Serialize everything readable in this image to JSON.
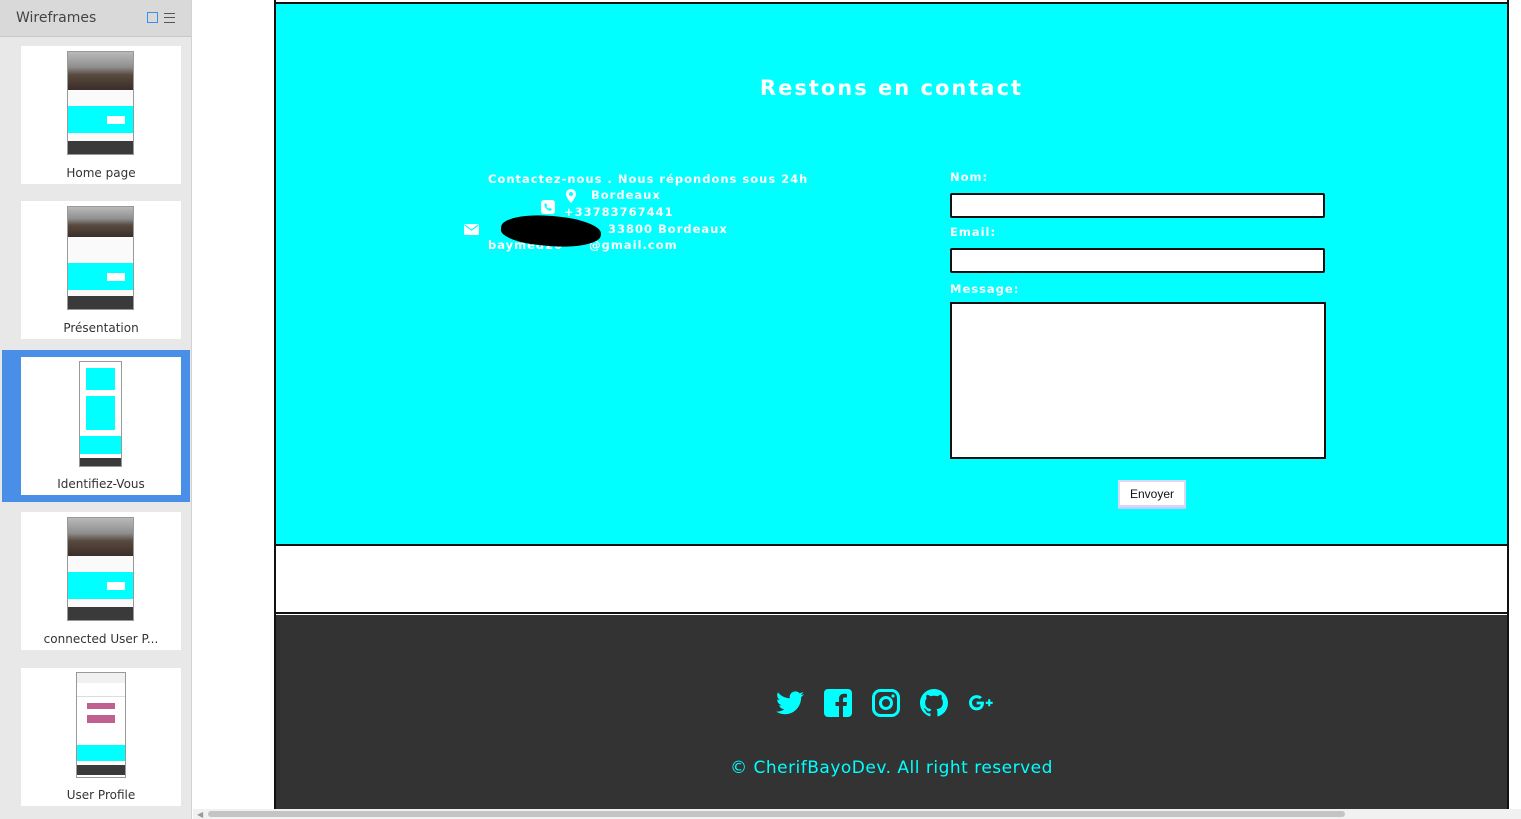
{
  "sidebar": {
    "title": "Wireframes",
    "pages": [
      {
        "label": "Home page"
      },
      {
        "label": "Présentation"
      },
      {
        "label": "Identifiez-Vous"
      },
      {
        "label": "connected User P..."
      },
      {
        "label": "User Profile"
      }
    ],
    "selected_index": 2
  },
  "contact": {
    "title": "Restons en contact",
    "intro": "Contactez-nous . Nous répondons sous 24h",
    "location": "Bordeaux",
    "phone": "+33783767441",
    "address_suffix": "33800 Bordeaux",
    "email_visible": "baymed20",
    "email_suffix": "@gmail.com"
  },
  "form": {
    "name_label": "Nom:",
    "email_label": "Email:",
    "message_label": "Message:",
    "submit_label": "Envoyer"
  },
  "footer": {
    "copyright": "©  CherifBayoDev. All right reserved",
    "social": [
      "twitter-icon",
      "facebook-icon",
      "instagram-icon",
      "github-icon",
      "google-plus-icon"
    ],
    "icon_color": "#00ffff"
  },
  "colors": {
    "accent": "#00ffff",
    "footer_bg": "#333333",
    "selection": "#4a8fe7"
  }
}
